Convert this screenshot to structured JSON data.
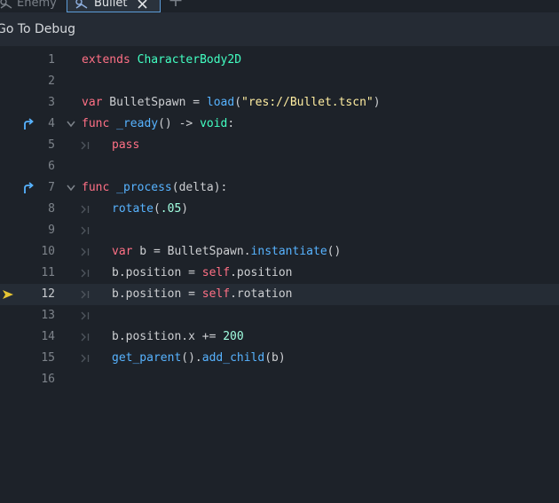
{
  "tabs": {
    "enemy_label": "Enemy",
    "bullet_label": "Bullet"
  },
  "menu": {
    "goto_label": "Go To",
    "debug_label": "Debug"
  },
  "colors": {
    "keyword": "#ff7085",
    "type": "#42ffc2",
    "function": "#57b3ff",
    "string": "#ffeda1",
    "number": "#a1ffe0",
    "text": "#cdcfd2",
    "accent": "#5c9cd8",
    "exec_arrow": "#e6c532"
  },
  "editor": {
    "current_line": 12,
    "lines": [
      {
        "n": "1",
        "indent": false,
        "tokens": [
          {
            "t": "extends",
            "c": "kw"
          },
          {
            "t": " ",
            "c": "txt"
          },
          {
            "t": "CharacterBody2D",
            "c": "type"
          }
        ]
      },
      {
        "n": "2",
        "indent": false,
        "tokens": []
      },
      {
        "n": "3",
        "indent": false,
        "tokens": [
          {
            "t": "var",
            "c": "kw"
          },
          {
            "t": " BulletSpawn = ",
            "c": "txt"
          },
          {
            "t": "load",
            "c": "fn"
          },
          {
            "t": "(",
            "c": "txt"
          },
          {
            "t": "\"res://Bullet.tscn\"",
            "c": "str"
          },
          {
            "t": ")",
            "c": "txt"
          }
        ]
      },
      {
        "n": "4",
        "indent": false,
        "override_icon": "override-arrow-icon",
        "fold": true,
        "tokens": [
          {
            "t": "func",
            "c": "kw"
          },
          {
            "t": " ",
            "c": "txt"
          },
          {
            "t": "_ready",
            "c": "fn"
          },
          {
            "t": "() -> ",
            "c": "txt"
          },
          {
            "t": "void",
            "c": "type"
          },
          {
            "t": ":",
            "c": "txt"
          }
        ]
      },
      {
        "n": "5",
        "indent": true,
        "tokens": [
          {
            "t": "pass",
            "c": "kw"
          }
        ]
      },
      {
        "n": "6",
        "indent": false,
        "tokens": []
      },
      {
        "n": "7",
        "indent": false,
        "override_icon": "override-arrow-icon",
        "fold": true,
        "tokens": [
          {
            "t": "func",
            "c": "kw"
          },
          {
            "t": " ",
            "c": "txt"
          },
          {
            "t": "_process",
            "c": "fn"
          },
          {
            "t": "(delta):",
            "c": "txt"
          }
        ]
      },
      {
        "n": "8",
        "indent": true,
        "tokens": [
          {
            "t": "rotate",
            "c": "fn"
          },
          {
            "t": "(",
            "c": "txt"
          },
          {
            "t": ".05",
            "c": "num"
          },
          {
            "t": ")",
            "c": "txt"
          }
        ]
      },
      {
        "n": "9",
        "indent": true,
        "tokens": []
      },
      {
        "n": "10",
        "indent": true,
        "tokens": [
          {
            "t": "var",
            "c": "kw"
          },
          {
            "t": " b = BulletSpawn.",
            "c": "txt"
          },
          {
            "t": "instantiate",
            "c": "fn"
          },
          {
            "t": "()",
            "c": "txt"
          }
        ]
      },
      {
        "n": "11",
        "indent": true,
        "tokens": [
          {
            "t": "b.position = ",
            "c": "txt"
          },
          {
            "t": "self",
            "c": "kw"
          },
          {
            "t": ".position",
            "c": "txt"
          }
        ]
      },
      {
        "n": "12",
        "indent": true,
        "exec_icon": "execution-arrow-icon",
        "tokens": [
          {
            "t": "b.position = ",
            "c": "txt"
          },
          {
            "t": "self",
            "c": "kw"
          },
          {
            "t": ".rotation",
            "c": "txt"
          }
        ]
      },
      {
        "n": "13",
        "indent": true,
        "tokens": []
      },
      {
        "n": "14",
        "indent": true,
        "tokens": [
          {
            "t": "b.position.x += ",
            "c": "txt"
          },
          {
            "t": "200",
            "c": "num"
          }
        ]
      },
      {
        "n": "15",
        "indent": true,
        "tokens": [
          {
            "t": "get_parent",
            "c": "fn"
          },
          {
            "t": "().",
            "c": "txt"
          },
          {
            "t": "add_child",
            "c": "fn"
          },
          {
            "t": "(b)",
            "c": "txt"
          }
        ]
      },
      {
        "n": "16",
        "indent": false,
        "tokens": []
      }
    ]
  }
}
